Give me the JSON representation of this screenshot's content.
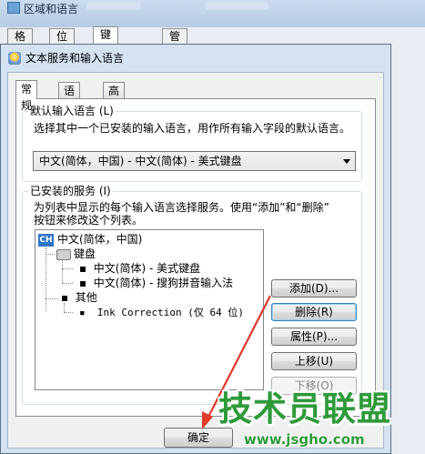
{
  "background_window": {
    "title": "区域和语言",
    "tabs": [
      "格式",
      "位置",
      "键盘和语言",
      "管理"
    ],
    "active_tab": "键盘和语言"
  },
  "dialog": {
    "title": "文本服务和输入语言",
    "tabs": [
      "常规",
      "语言栏",
      "高级键设置"
    ],
    "active_tab": "常规",
    "default_language": {
      "legend": "默认输入语言 (L)",
      "description": "选择其中一个已安装的输入语言，用作所有输入字段的默认语言。",
      "selected": "中文(简体，中国) - 中文(简体) - 美式键盘"
    },
    "installed_services": {
      "legend": "已安装的服务 (I)",
      "description_line1": "为列表中显示的每个输入语言选择服务。使用“添加”和“删除”",
      "description_line2": "按钮来修改这个列表。",
      "tree": {
        "language": "中文(简体，中国)",
        "language_icon_text": "CH",
        "keyboard_group": "键盘",
        "keyboard_items": [
          "中文(简体) - 美式键盘",
          "中文(简体) - 搜狗拼音输入法"
        ],
        "other_group": "其他",
        "other_items": [
          "Ink Correction (仅 64 位)"
        ]
      },
      "buttons": {
        "add": "添加(D)...",
        "remove": "删除(R)",
        "properties": "属性(P)...",
        "move_up": "上移(U)",
        "move_down": "下移(O)"
      }
    },
    "ok_button": "确定"
  },
  "watermark": {
    "main": "技术员联盟",
    "sub": "www.jsgho.com"
  },
  "colors": {
    "accent_blue": "#2f76c9",
    "annotation_arrow": "#e03a2c",
    "watermark_green": "#2e9a3a"
  }
}
